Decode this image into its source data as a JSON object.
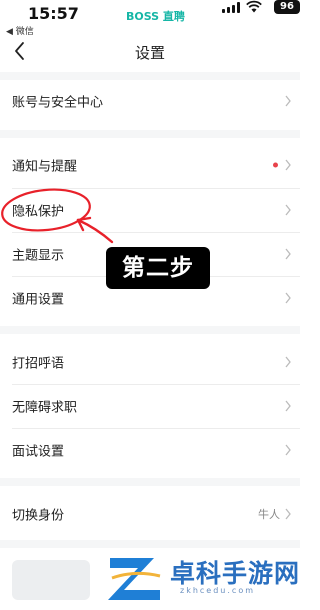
{
  "status_bar": {
    "time": "15:57",
    "back_app": "◀ 微信",
    "brand": "BOSS 直聘",
    "battery": "96"
  },
  "nav": {
    "title": "设置"
  },
  "menu": [
    {
      "label": "账号与安全中心"
    },
    {
      "label": "通知与提醒",
      "has_red_dot": true
    },
    {
      "label": "隐私保护"
    },
    {
      "label": "主题显示"
    },
    {
      "label": "通用设置"
    },
    {
      "label": "打招呼语"
    },
    {
      "label": "无障碍求职"
    },
    {
      "label": "面试设置"
    },
    {
      "label": "切换身份",
      "value": "牛人"
    }
  ],
  "annotation": {
    "callout": "第二步",
    "color": "#e8212a"
  },
  "watermark": {
    "text": "卓科手游网",
    "url": "zkhcedu.com"
  },
  "colors": {
    "brand": "#16b6a6",
    "red_dot": "#e8434b",
    "annotation": "#e8212a",
    "watermark": "#2a6fbf"
  }
}
